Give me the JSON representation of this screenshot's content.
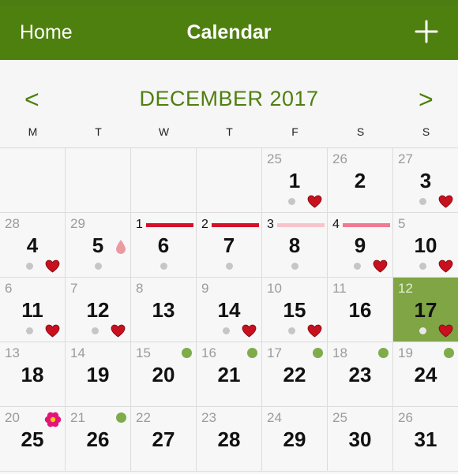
{
  "nav": {
    "home_label": "Home",
    "title": "Calendar",
    "add_icon": "plus-icon"
  },
  "header": {
    "month_label": "DECEMBER 2017",
    "prev_glyph": "<",
    "next_glyph": ">"
  },
  "weekdays": [
    "M",
    "T",
    "W",
    "T",
    "F",
    "S",
    "S"
  ],
  "colors": {
    "brand_green": "#4e800f",
    "today_green": "#7fa544",
    "heart_red": "#c8101e",
    "period_dark": "#d4102b",
    "period_light": "#f8c4cb",
    "period_mid": "#f07a92",
    "event_green": "#7fac4a",
    "flower_pink": "#e4147b"
  },
  "weeks": [
    [
      {
        "small": "",
        "big": ""
      },
      {
        "small": "",
        "big": ""
      },
      {
        "small": "",
        "big": ""
      },
      {
        "small": "",
        "big": ""
      },
      {
        "small": "25",
        "big": "1",
        "dot": true,
        "heart": true
      },
      {
        "small": "26",
        "big": "2"
      },
      {
        "small": "27",
        "big": "3",
        "dot": true,
        "heart": true
      }
    ],
    [
      {
        "small": "28",
        "big": "4",
        "dot": true,
        "heart": true
      },
      {
        "small": "29",
        "big": "5",
        "dot": true,
        "drop": true
      },
      {
        "small": "",
        "big": "6",
        "dot": true,
        "cycle": "1",
        "bar": "dark"
      },
      {
        "small": "",
        "big": "7",
        "dot": true,
        "cycle": "2",
        "bar": "dark"
      },
      {
        "small": "",
        "big": "8",
        "dot": true,
        "cycle": "3",
        "bar": "light"
      },
      {
        "small": "",
        "big": "9",
        "dot": true,
        "heart": true,
        "cycle": "4",
        "bar": "mid"
      },
      {
        "small": "5",
        "big": "10",
        "dot": true,
        "heart": true
      }
    ],
    [
      {
        "small": "6",
        "big": "11",
        "dot": true,
        "heart": true
      },
      {
        "small": "7",
        "big": "12",
        "dot": true,
        "heart": true
      },
      {
        "small": "8",
        "big": "13"
      },
      {
        "small": "9",
        "big": "14",
        "dot": true,
        "heart": true
      },
      {
        "small": "10",
        "big": "15",
        "dot": true,
        "heart": true
      },
      {
        "small": "11",
        "big": "16"
      },
      {
        "small": "12",
        "big": "17",
        "dot": true,
        "heart": true,
        "today": true
      }
    ],
    [
      {
        "small": "13",
        "big": "18"
      },
      {
        "small": "14",
        "big": "19"
      },
      {
        "small": "15",
        "big": "20",
        "event": true
      },
      {
        "small": "16",
        "big": "21",
        "event": true
      },
      {
        "small": "17",
        "big": "22",
        "event": true
      },
      {
        "small": "18",
        "big": "23",
        "event": true
      },
      {
        "small": "19",
        "big": "24",
        "event": true
      }
    ],
    [
      {
        "small": "20",
        "big": "25",
        "flower": true
      },
      {
        "small": "21",
        "big": "26",
        "event": true
      },
      {
        "small": "22",
        "big": "27"
      },
      {
        "small": "23",
        "big": "28"
      },
      {
        "small": "24",
        "big": "29"
      },
      {
        "small": "25",
        "big": "30"
      },
      {
        "small": "26",
        "big": "31"
      }
    ]
  ]
}
